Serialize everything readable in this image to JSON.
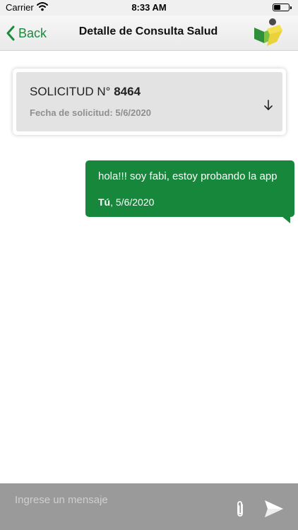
{
  "status_bar": {
    "carrier": "Carrier",
    "time": "8:33 AM",
    "icons": [
      "wifi-icon",
      "battery-icon"
    ]
  },
  "nav": {
    "back_label": "Back",
    "title": "Detalle de Consulta Salud",
    "icons": [
      "chevron-left-icon",
      "logo-icon"
    ]
  },
  "request": {
    "label": "SOLICITUD N°",
    "number": "8464",
    "date_label": "Fecha de solicitud: 5/6/2020",
    "icon": "arrow-down-icon"
  },
  "messages": [
    {
      "text": "hola!!! soy fabi, estoy probando la app",
      "author": "Tú",
      "date": ", 5/6/2020"
    }
  ],
  "composer": {
    "placeholder": "Ingrese un mensaje",
    "value": "",
    "icons": [
      "paperclip-icon",
      "send-icon"
    ]
  },
  "colors": {
    "accent": "#1a8a3d",
    "bubble": "#17873b",
    "input_bar": "#9a9a9a",
    "card_inner": "#e3e3e3"
  }
}
